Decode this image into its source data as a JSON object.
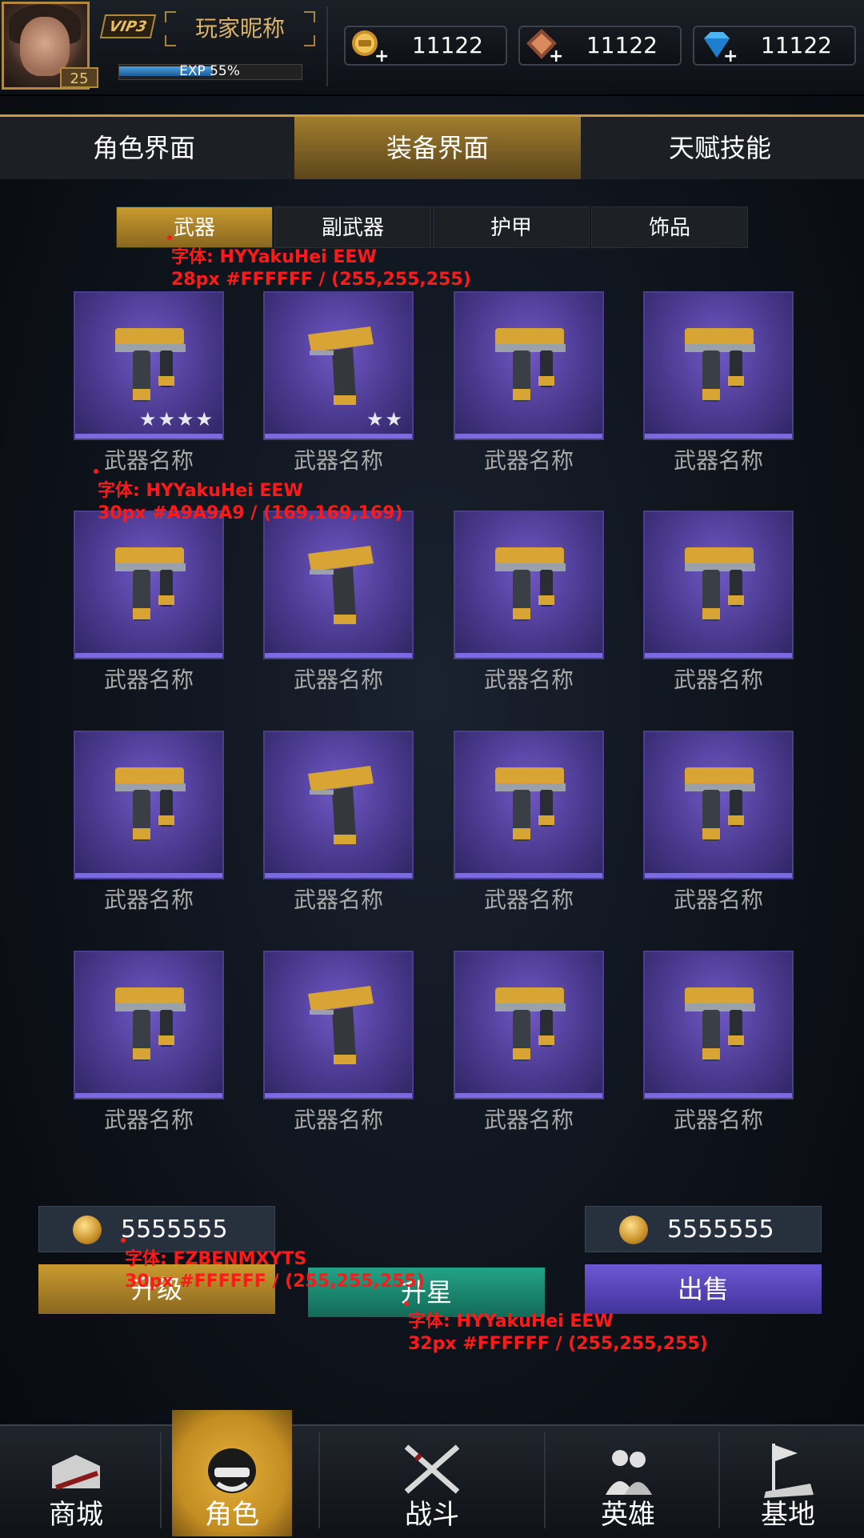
{
  "player": {
    "level": "25",
    "vip": "VIP3",
    "nickname": "玩家昵称",
    "exp_text": "EXP 55%",
    "exp_percent": 55
  },
  "currencies": [
    {
      "icon": "gold-coin-icon",
      "value": "11122"
    },
    {
      "icon": "badge-token-icon",
      "value": "11122"
    },
    {
      "icon": "diamond-icon",
      "value": "11122"
    }
  ],
  "main_tabs": [
    {
      "label": "角色界面",
      "active": false
    },
    {
      "label": "装备界面",
      "active": true
    },
    {
      "label": "天赋技能",
      "active": false
    }
  ],
  "sub_tabs": [
    {
      "label": "武器",
      "active": true
    },
    {
      "label": "副武器",
      "active": false
    },
    {
      "label": "护甲",
      "active": false
    },
    {
      "label": "饰品",
      "active": false
    }
  ],
  "weapons": [
    {
      "name": "武器名称",
      "gun": "smg",
      "stars": "★★★★"
    },
    {
      "name": "武器名称",
      "gun": "pistol",
      "stars": "★★"
    },
    {
      "name": "武器名称",
      "gun": "smg",
      "stars": ""
    },
    {
      "name": "武器名称",
      "gun": "smg",
      "stars": ""
    },
    {
      "name": "武器名称",
      "gun": "smg",
      "stars": ""
    },
    {
      "name": "武器名称",
      "gun": "pistol",
      "stars": ""
    },
    {
      "name": "武器名称",
      "gun": "smg",
      "stars": ""
    },
    {
      "name": "武器名称",
      "gun": "smg",
      "stars": ""
    },
    {
      "name": "武器名称",
      "gun": "smg",
      "stars": ""
    },
    {
      "name": "武器名称",
      "gun": "pistol",
      "stars": ""
    },
    {
      "name": "武器名称",
      "gun": "smg",
      "stars": ""
    },
    {
      "name": "武器名称",
      "gun": "smg",
      "stars": ""
    },
    {
      "name": "武器名称",
      "gun": "smg",
      "stars": ""
    },
    {
      "name": "武器名称",
      "gun": "pistol",
      "stars": ""
    },
    {
      "name": "武器名称",
      "gun": "smg",
      "stars": ""
    },
    {
      "name": "武器名称",
      "gun": "smg",
      "stars": ""
    }
  ],
  "annotations": {
    "tab_font_line1": "字体: HYYakuHei EEW",
    "tab_font_line2": "28px #FFFFFF / (255,255,255)",
    "name_font_line1": "字体: HYYakuHei EEW",
    "name_font_line2": "30px #A9A9A9 / (169,169,169)",
    "price_font_line1": "字体: FZBENMXYTS",
    "price_font_line2": "30px #FFFFFF / (255,255,255)",
    "button_font_line1": "字体: HYYakuHei EEW",
    "button_font_line2": "32px #FFFFFF / (255,255,255)"
  },
  "actions": {
    "left_price": "5555555",
    "right_price": "5555555",
    "upgrade_label": "升级",
    "star_label": "升星",
    "sell_label": "出售"
  },
  "nav": [
    {
      "label": "商城",
      "icon": "shop-icon",
      "active": false
    },
    {
      "label": "角色",
      "icon": "helmet-icon",
      "active": true
    },
    {
      "label": "战斗",
      "icon": "crossed-rifles-icon",
      "active": false
    },
    {
      "label": "英雄",
      "icon": "heroes-icon",
      "active": false
    },
    {
      "label": "基地",
      "icon": "base-flag-icon",
      "active": false
    }
  ],
  "colors": {
    "gold": "#c89b3e",
    "purple_card": "#4a3a8f",
    "teal_button": "#1f8a73",
    "sell_button": "#5a48b8",
    "annotation": "#ff1a1a"
  }
}
